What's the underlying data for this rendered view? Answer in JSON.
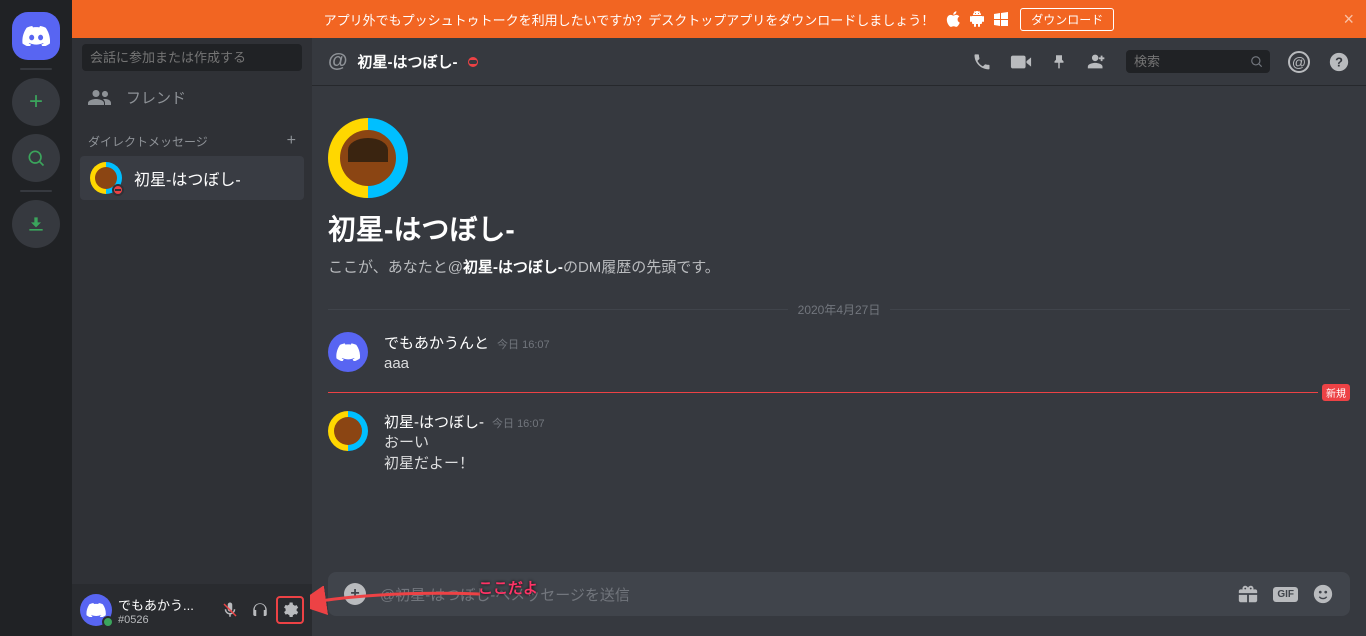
{
  "banner": {
    "text": "アプリ外でもプッシュトゥトークを利用したいですか？デスクトップアプリをダウンロードしましょう！",
    "download_btn": "ダウンロード"
  },
  "sidebar": {
    "search_placeholder": "会話に参加または作成する",
    "friends_label": "フレンド",
    "dm_header": "ダイレクトメッセージ",
    "dm_items": [
      {
        "name": "初星-はつぼし-"
      }
    ]
  },
  "user": {
    "name": "でもあかう...",
    "tag": "#0526"
  },
  "chat": {
    "title": "初星-はつぼし-",
    "search_placeholder": "検索",
    "welcome_title": "初星-はつぼし-",
    "welcome_prefix": "ここが、あなたと@",
    "welcome_name": "初星-はつぼし-",
    "welcome_suffix": "のDM履歴の先頭です。",
    "date_divider": "2020年4月27日",
    "new_label": "新規",
    "messages": [
      {
        "author": "でもあかうんと",
        "day": "今日",
        "time": "16:07",
        "lines": [
          "aaa"
        ]
      },
      {
        "author": "初星-はつぼし-",
        "day": "今日",
        "time": "16:07",
        "lines": [
          "おーい",
          "初星だよー！"
        ]
      }
    ],
    "input_placeholder": "@初星-はつぼし-へメッセージを送信",
    "gif_label": "GIF"
  },
  "annotation": {
    "label": "ここだよ"
  }
}
